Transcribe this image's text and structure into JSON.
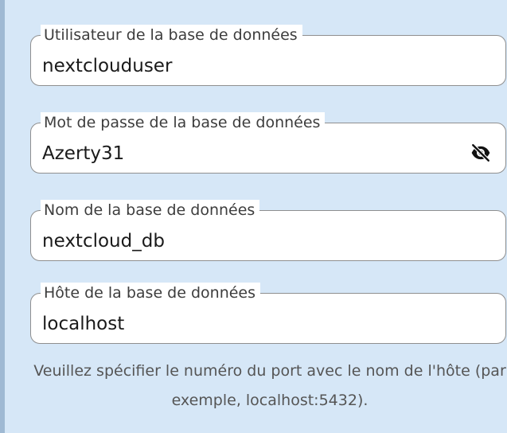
{
  "database_form": {
    "user": {
      "label": "Utilisateur de la base de données",
      "value": "nextclouduser"
    },
    "password": {
      "label": "Mot de passe de la base de données",
      "value": "Azerty31",
      "visibility_icon": "eye-slash-icon"
    },
    "name": {
      "label": "Nom de la base de données",
      "value": "nextcloud_db"
    },
    "host": {
      "label": "Hôte de la base de données",
      "value": "localhost"
    },
    "help_text": "Veuillez spécifier le numéro du port avec le nom de l'hôte (par exemple, localhost:5432)."
  },
  "colors": {
    "background": "#d6e7f7",
    "field_border": "#8f8f8f",
    "label_text": "#3d3d3d",
    "help_text": "#555555"
  }
}
